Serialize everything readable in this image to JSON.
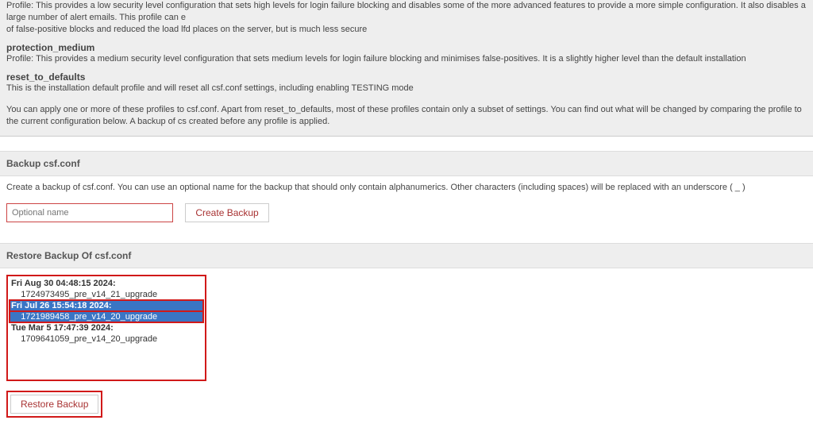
{
  "truncated_profile": {
    "name": "",
    "line1": "Profile: This provides a low security level configuration that sets high levels for login failure blocking and disables some of the more advanced features to provide a more simple configuration. It also disables a large number of alert emails. This profile can e",
    "line2": "of false-positive blocks and reduced the load lfd places on the server, but is much less secure"
  },
  "profiles": [
    {
      "name": "protection_medium",
      "desc": "Profile: This provides a medium security level configuration that sets medium levels for login failure blocking and minimises false-positives. It is a slightly higher level than the default installation"
    },
    {
      "name": "reset_to_defaults",
      "desc": "This is the installation default profile and will reset all csf.conf settings, including enabling TESTING mode"
    }
  ],
  "apply_note": "You can apply one or more of these profiles to csf.conf. Apart from reset_to_defaults, most of these profiles contain only a subset of settings. You can find out what will be changed by comparing the profile to the current configuration below. A backup of cs created before any profile is applied.",
  "backup": {
    "heading": "Backup csf.conf",
    "text": "Create a backup of csf.conf. You can use an optional name for the backup that should only contain alphanumerics. Other characters (including spaces) will be replaced with an underscore ( _ )",
    "placeholder": "Optional name",
    "button": "Create Backup"
  },
  "restore": {
    "heading": "Restore Backup Of csf.conf",
    "button": "Restore Backup",
    "options": [
      {
        "head": "Fri Aug 30 04:48:15 2024:",
        "sub": "1724973495_pre_v14_21_upgrade",
        "selected": false
      },
      {
        "head": "Fri Jul 26 15:54:18 2024:",
        "sub": "1721989458_pre_v14_20_upgrade",
        "selected": true
      },
      {
        "head": "Tue Mar 5 17:47:39 2024:",
        "sub": "1709641059_pre_v14_20_upgrade",
        "selected": false
      }
    ]
  }
}
